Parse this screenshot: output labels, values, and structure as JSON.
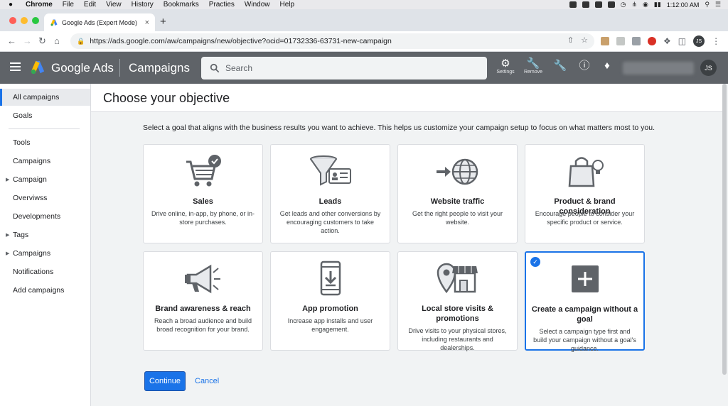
{
  "menubar": {
    "app": "Chrome",
    "items": [
      "File",
      "Edit",
      "View",
      "History",
      "Bookmarks",
      "Practies",
      "Window",
      "Help"
    ],
    "time": "1:12:00 AM"
  },
  "browser": {
    "tab_title": "Google Ads (Expert Mode)",
    "url": "https://ads.google.com/aw/campaigns/new/objective?ocid=01732336-63731-new-campaign",
    "profile_initials": "JS"
  },
  "ads_header": {
    "brand": "Google Ads",
    "section": "Campaigns",
    "search_placeholder": "Search",
    "settings_label": "Settings",
    "remove_label": "Remove",
    "avatar_initials": "JS"
  },
  "sidebar": {
    "items": [
      {
        "label": "All campaigns",
        "active": true
      },
      {
        "label": "Goals"
      },
      {
        "label": "Tools"
      },
      {
        "label": "Campaigns"
      },
      {
        "label": "Campaign",
        "expandable": true
      },
      {
        "label": "Overviwss"
      },
      {
        "label": "Developments"
      },
      {
        "label": "Tags",
        "expandable": true
      },
      {
        "label": "Campaigns",
        "expandable": true
      },
      {
        "label": "Notifications"
      },
      {
        "label": "Add campaigns"
      }
    ]
  },
  "main": {
    "title": "Choose your objective",
    "intro": "Select a goal that aligns with the business results you want to achieve. This helps us customize your campaign setup to focus on what matters most to you.",
    "cards": [
      {
        "title": "Sales",
        "desc": "Drive online, in-app, by phone, or in-store purchases.",
        "icon": "shopping-cart-icon"
      },
      {
        "title": "Leads",
        "desc": "Get leads and other conversions by encouraging customers to take action.",
        "icon": "funnel-icon"
      },
      {
        "title": "Website traffic",
        "desc": "Get the right people to visit your website.",
        "icon": "globe-icon"
      },
      {
        "title": "Product & brand consideration",
        "desc": "Encourage people to consider your specific product or service.",
        "icon": "shopping-bag-icon"
      },
      {
        "title": "Brand awareness & reach",
        "desc": "Reach a broad audience and build broad recognition for your brand.",
        "icon": "megaphone-icon"
      },
      {
        "title": "App promotion",
        "desc": "Increase app installs and user engagement.",
        "icon": "phone-download-icon"
      },
      {
        "title": "Local store visits & promotions",
        "desc": "Drive visits to your physical stores, including restaurants and dealerships.",
        "icon": "store-pin-icon"
      },
      {
        "title": "Create a campaign without a goal",
        "desc": "Select a campaign type first and build your campaign without a goal's guidance.",
        "icon": "plus-icon",
        "selected": true
      }
    ],
    "continue_label": "Continue",
    "cancel_label": "Cancel"
  },
  "colors": {
    "accent": "#1a73e8",
    "header_bg": "#5f6368",
    "icon_gray": "#5f6368"
  }
}
